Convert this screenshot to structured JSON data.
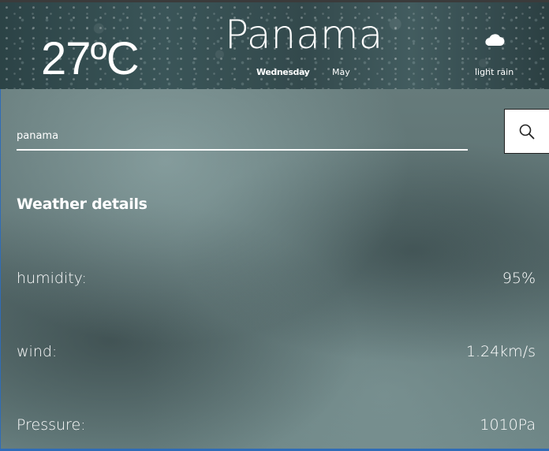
{
  "header": {
    "temperature": "27ºC",
    "city": "Panama",
    "day": "Wednesday",
    "month": "May",
    "condition_icon": "cloud-icon",
    "condition": "light rain"
  },
  "search": {
    "value": "panama",
    "placeholder": "",
    "button_icon": "search-icon"
  },
  "details": {
    "title": "Weather details",
    "rows": [
      {
        "label": "humidity:",
        "value": "95%"
      },
      {
        "label": "wind:",
        "value": "1.24km/s"
      },
      {
        "label": "Pressure:",
        "value": "1010Pa"
      }
    ]
  },
  "colors": {
    "accent_border": "#2f6cb8",
    "text": "#ffffff"
  }
}
